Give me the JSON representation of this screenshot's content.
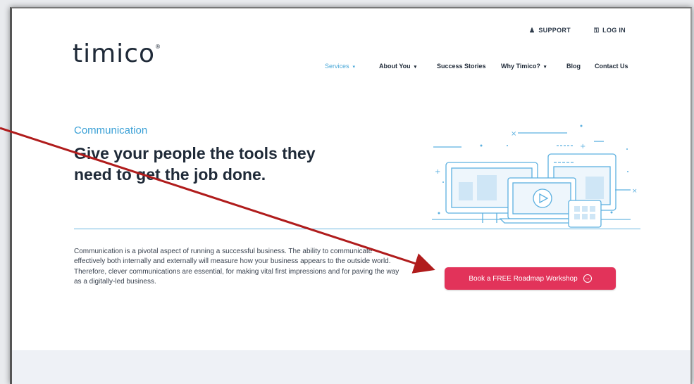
{
  "utility_nav": {
    "support_label": "SUPPORT",
    "login_label": "LOG IN"
  },
  "logo": {
    "text": "timico",
    "mark": "®"
  },
  "nav": {
    "items": [
      {
        "label": "Services",
        "dropdown": true,
        "active": true
      },
      {
        "label": "About You",
        "dropdown": true,
        "active": false
      },
      {
        "label": "Success Stories",
        "dropdown": false,
        "active": false
      },
      {
        "label": "Why Timico?",
        "dropdown": true,
        "active": false
      },
      {
        "label": "Blog",
        "dropdown": false,
        "active": false
      },
      {
        "label": "Contact Us",
        "dropdown": false,
        "active": false
      }
    ]
  },
  "hero": {
    "eyebrow": "Communication",
    "headline_line1": "Give your people the tools they",
    "headline_line2": "need to get the job done.",
    "body": "Communication is a pivotal aspect of running a successful business. The ability to communicate effectively both internally and externally will measure how your business appears to the outside world. Therefore, clever communications are essential, for making vital first impressions and for paving the way as a digitally-led business.",
    "cta_label": "Book a FREE Roadmap Workshop"
  },
  "colors": {
    "accent_blue": "#3aa0d6",
    "cta_red": "#e2335a",
    "annotation_arrow": "#b01c1c",
    "text_dark": "#1f2a38"
  },
  "icons": {
    "support": "user-icon",
    "login": "key-icon",
    "cta": "arrow-circle-right-icon",
    "illustration": "devices-illustration"
  }
}
